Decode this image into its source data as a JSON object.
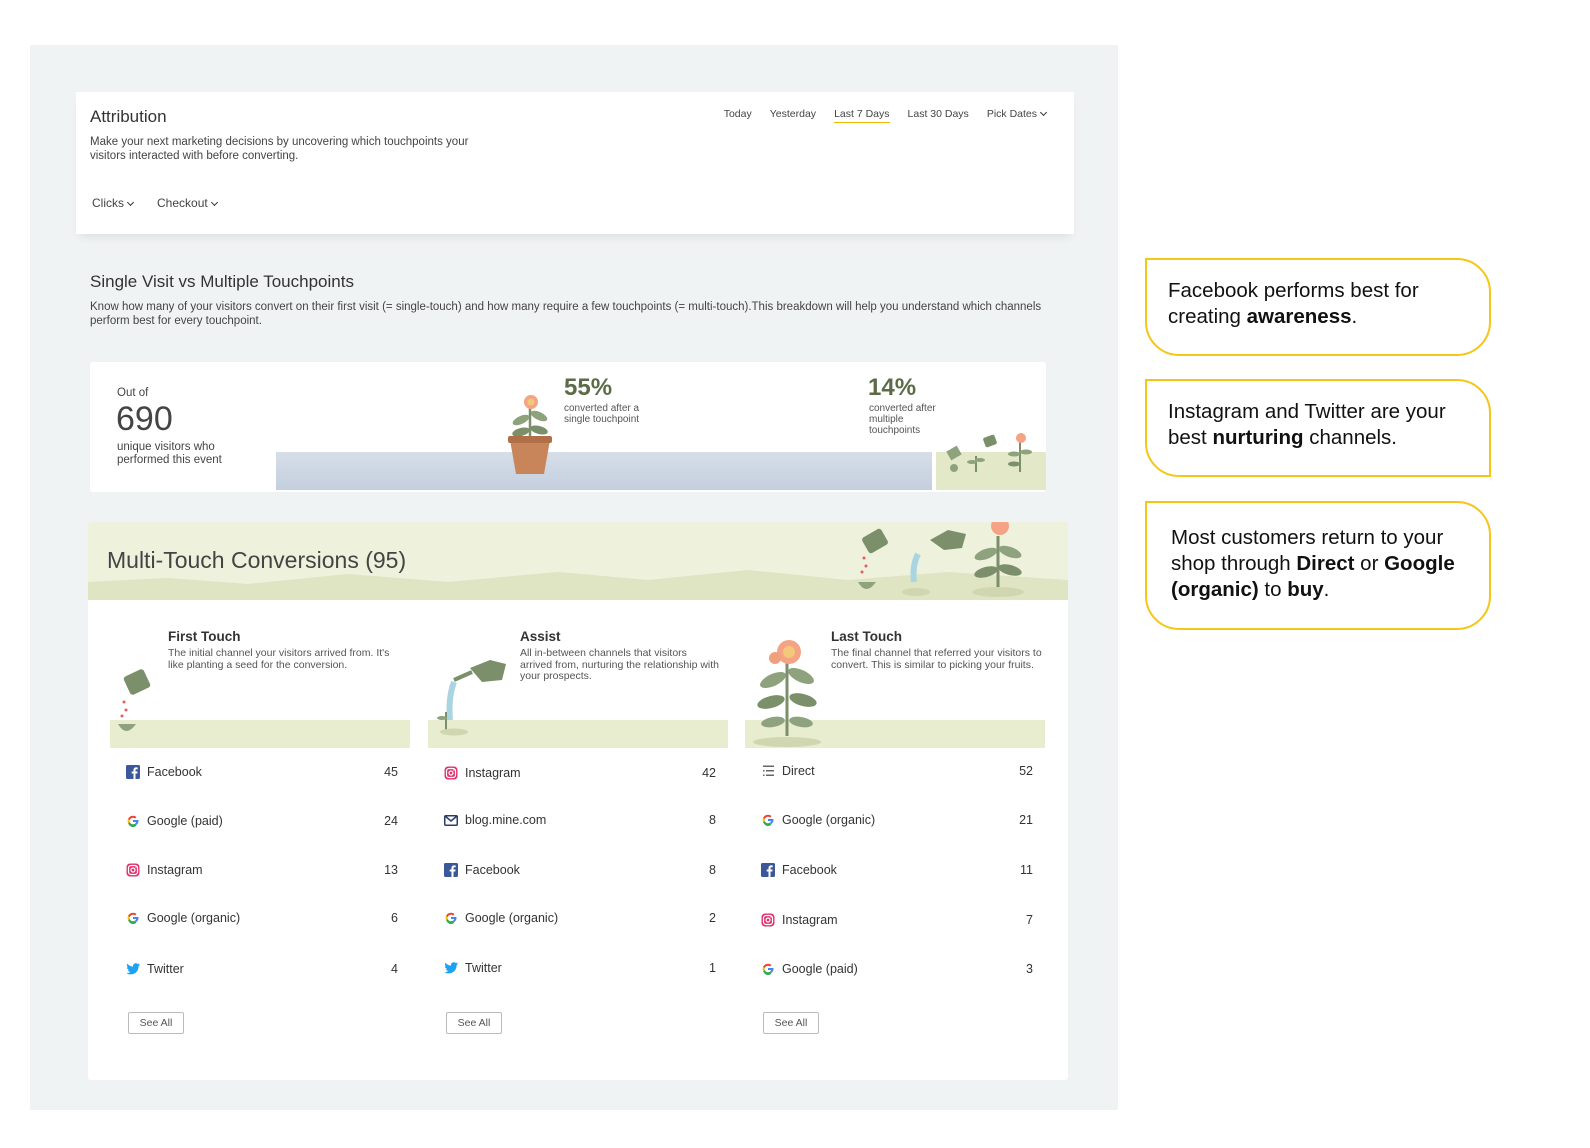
{
  "header": {
    "title": "Attribution",
    "description": "Make your next marketing decisions by uncovering which touchpoints your visitors interacted with before converting.",
    "date_tabs": [
      "Today",
      "Yesterday",
      "Last 7 Days",
      "Last 30 Days",
      "Pick Dates"
    ],
    "active_date_tab": "Last 7 Days",
    "filters": [
      "Clicks",
      "Checkout"
    ]
  },
  "single_vs_multi": {
    "title": "Single Visit vs Multiple Touchpoints",
    "description": "Know how many of your visitors convert on their first visit (= single-touch) and how many require a few touchpoints (= multi-touch).This breakdown will help you understand which channels perform best for every touchpoint.",
    "out_of_label": "Out of",
    "total_visitors": "690",
    "visitors_label": "unique visitors who performed this event",
    "single_pct": "55%",
    "single_label": "converted after a single touchpoint",
    "multi_pct": "14%",
    "multi_label": "converted after multiple touchpoints",
    "single_share": 0.55,
    "multi_share": 0.14
  },
  "multi_touch": {
    "title": "Multi-Touch Conversions (95)",
    "columns": [
      {
        "title": "First Touch",
        "description": "The initial channel your visitors arrived from. It's like planting a seed for the conversion.",
        "rows": [
          {
            "icon": "facebook-icon",
            "name": "Facebook",
            "value": "45"
          },
          {
            "icon": "google-icon",
            "name": "Google (paid)",
            "value": "24"
          },
          {
            "icon": "instagram-icon",
            "name": "Instagram",
            "value": "13"
          },
          {
            "icon": "google-icon",
            "name": "Google (organic)",
            "value": "6"
          },
          {
            "icon": "twitter-icon",
            "name": "Twitter",
            "value": "4"
          }
        ],
        "see_all": "See All"
      },
      {
        "title": "Assist",
        "description": "All in-between channels that visitors arrived from, nurturing the relationship with your prospects.",
        "rows": [
          {
            "icon": "instagram-icon",
            "name": "Instagram",
            "value": "42"
          },
          {
            "icon": "email-icon",
            "name": "blog.mine.com",
            "value": "8"
          },
          {
            "icon": "facebook-icon",
            "name": "Facebook",
            "value": "8"
          },
          {
            "icon": "google-icon",
            "name": "Google (organic)",
            "value": "2"
          },
          {
            "icon": "twitter-icon",
            "name": "Twitter",
            "value": "1"
          }
        ],
        "see_all": "See All"
      },
      {
        "title": "Last Touch",
        "description": "The final channel that referred your visitors to convert. This is similar to picking your fruits.",
        "rows": [
          {
            "icon": "direct-icon",
            "name": "Direct",
            "value": "52"
          },
          {
            "icon": "google-icon",
            "name": "Google (organic)",
            "value": "21"
          },
          {
            "icon": "facebook-icon",
            "name": "Facebook",
            "value": "11"
          },
          {
            "icon": "instagram-icon",
            "name": "Instagram",
            "value": "7"
          },
          {
            "icon": "google-icon",
            "name": "Google (paid)",
            "value": "3"
          }
        ],
        "see_all": "See All"
      }
    ]
  },
  "callouts": [
    {
      "pre": "Facebook performs best for creating ",
      "bold": "awareness",
      "post": "."
    },
    {
      "pre": "Instagram and Twitter are your best ",
      "bold": "nurturing",
      "post": " channels."
    },
    {
      "parts": [
        "Most customers return to your shop through ",
        "Direct",
        " or ",
        "Google (organic)",
        " to ",
        "buy",
        "."
      ]
    }
  ],
  "colors": {
    "accent": "#f5c518",
    "facebook": "#3b5998",
    "twitter": "#1da1f2",
    "instagram": "#e1306c",
    "google_blue": "#4285f4",
    "plant_green": "#7a8f6a",
    "flower": "#f0a07a"
  }
}
